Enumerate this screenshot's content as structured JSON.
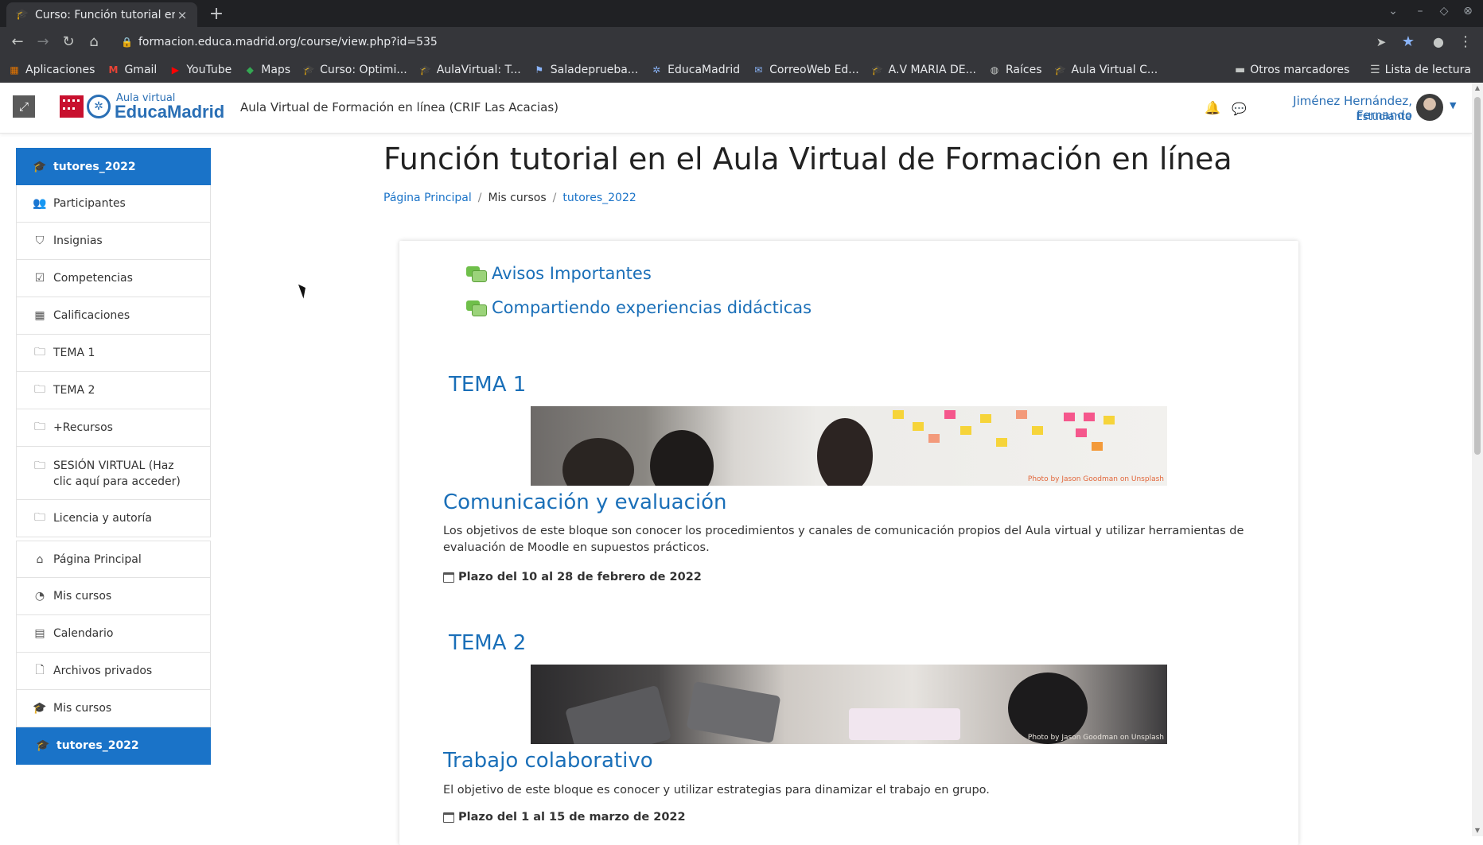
{
  "browser": {
    "tab_title": "Curso: Función tutorial en el A",
    "tab_close": "×",
    "new_tab": "+",
    "url": "formacion.educa.madrid.org/course/view.php?id=535",
    "bookmarks": [
      {
        "label": "Aplicaciones",
        "icon": "apps-grid-icon"
      },
      {
        "label": "Gmail",
        "icon": "gmail-icon"
      },
      {
        "label": "YouTube",
        "icon": "youtube-icon"
      },
      {
        "label": "Maps",
        "icon": "maps-icon"
      },
      {
        "label": "Curso: Optimi...",
        "icon": "moodle-cap-icon"
      },
      {
        "label": "AulaVirtual: T...",
        "icon": "moodle-cap-icon"
      },
      {
        "label": "Saladeprueba...",
        "icon": "chat-flag-icon"
      },
      {
        "label": "EducaMadrid",
        "icon": "educamadrid-icon"
      },
      {
        "label": "CorreoWeb Ed...",
        "icon": "mail-icon"
      },
      {
        "label": "A.V MARIA DE...",
        "icon": "moodle-cap-icon"
      },
      {
        "label": "Raíces",
        "icon": "globe-icon"
      },
      {
        "label": "Aula Virtual C...",
        "icon": "moodle-cap-icon"
      }
    ],
    "other_bookmarks": "Otros marcadores",
    "reading_list": "Lista de lectura"
  },
  "header": {
    "logo_small": "Aula virtual",
    "logo_big": "EducaMadrid",
    "site_title": "Aula Virtual de Formación en línea (CRIF Las Acacias)",
    "user_name": "Jiménez Hernández, Fernando",
    "user_role": "Estudiante"
  },
  "sidebar": {
    "items": [
      {
        "label": "tutores_2022",
        "icon": "graduation-cap-icon",
        "active": true
      },
      {
        "label": "Participantes",
        "icon": "users-icon"
      },
      {
        "label": "Insignias",
        "icon": "shield-icon"
      },
      {
        "label": "Competencias",
        "icon": "check-square-icon"
      },
      {
        "label": "Calificaciones",
        "icon": "table-icon"
      },
      {
        "label": "TEMA 1",
        "icon": "folder-icon"
      },
      {
        "label": "TEMA 2",
        "icon": "folder-icon"
      },
      {
        "label": "+Recursos",
        "icon": "folder-icon"
      },
      {
        "label": "SESIÓN VIRTUAL (Haz clic aquí para acceder)",
        "icon": "folder-icon"
      },
      {
        "label": "Licencia y autoría",
        "icon": "folder-icon"
      },
      {
        "label": "Página Principal",
        "icon": "home-icon"
      },
      {
        "label": "Mis cursos",
        "icon": "dashboard-icon"
      },
      {
        "label": "Calendario",
        "icon": "calendar-icon"
      },
      {
        "label": "Archivos privados",
        "icon": "file-icon"
      },
      {
        "label": "Mis cursos",
        "icon": "graduation-cap-icon"
      },
      {
        "label": "tutores_2022",
        "icon": "graduation-cap-icon",
        "active": true
      }
    ]
  },
  "main": {
    "title": "Función tutorial en el Aula Virtual de Formación en línea",
    "breadcrumb": [
      "Página Principal",
      "Mis cursos",
      "tutores_2022"
    ],
    "breadcrumb_sep": "/",
    "forums": [
      "Avisos Importantes",
      "Compartiendo experiencias didácticas"
    ],
    "sections": [
      {
        "heading": "TEMA 1",
        "image_credit": "Photo by Jason Goodman on Unsplash",
        "lesson_title": "Comunicación y evaluación",
        "description": "Los objetivos de este bloque son conocer los procedimientos y canales de comunicación propios del Aula virtual y utilizar herramientas de evaluación de Moodle en supuestos prácticos.",
        "deadline": "Plazo del 10 al 28 de febrero de 2022"
      },
      {
        "heading": "TEMA 2",
        "image_credit": "Photo by Jason Goodman on Unsplash",
        "lesson_title": "Trabajo colaborativo",
        "description": "El objetivo de este bloque es conocer y utilizar estrategias para dinamizar el trabajo en grupo.",
        "deadline": "Plazo del 1 al 15 de marzo de 2022"
      }
    ]
  },
  "colors": {
    "accent": "#1a73c8",
    "link": "#1a6fb8",
    "chrome_dark": "#35363a"
  }
}
